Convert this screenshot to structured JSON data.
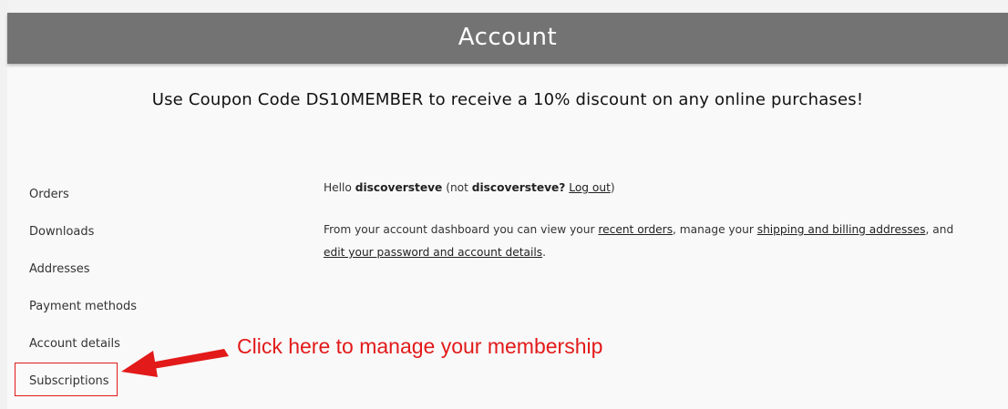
{
  "header": {
    "title": "Account"
  },
  "notice": {
    "coupon_text": "Use Coupon Code DS10MEMBER to receive a 10% discount on any online purchases!"
  },
  "sidebar": {
    "items": [
      {
        "label": "Orders"
      },
      {
        "label": "Downloads"
      },
      {
        "label": "Addresses"
      },
      {
        "label": "Payment methods"
      },
      {
        "label": "Account details"
      },
      {
        "label": "Subscriptions"
      }
    ]
  },
  "main": {
    "greeting_hello": "Hello",
    "username": "discoversteve",
    "greeting_not": "(not",
    "username_q": "discoversteve?",
    "logout": "Log out",
    "greeting_close": ")",
    "dashboard_intro": "From your account dashboard you can view your",
    "recent_orders": "recent orders",
    "manage_text": ", manage your",
    "addresses_link": "shipping and billing addresses",
    "and_text": ", and",
    "account_details_link": "edit your password and account details",
    "period": "."
  },
  "annotation": {
    "text": "Click here to manage your membership",
    "color": "#e21a1a"
  },
  "colors": {
    "banner": "#737373",
    "background": "#f9f9f9",
    "highlight": "#e21a1a"
  }
}
